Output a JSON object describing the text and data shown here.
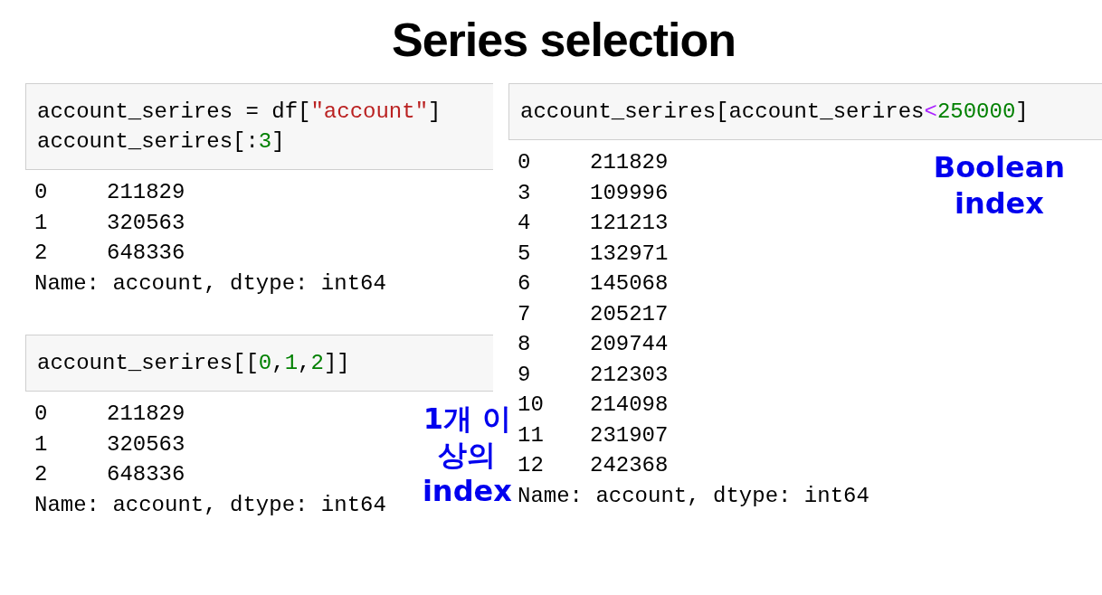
{
  "title": "Series selection",
  "columns": [
    [
      {
        "code_lines": [
          [
            {
              "kind": "plain",
              "text": "account_serires = df["
            },
            {
              "kind": "string",
              "text": "\"account\""
            },
            {
              "kind": "plain",
              "text": "]"
            }
          ],
          [
            {
              "kind": "plain",
              "text": "account_serires[:"
            },
            {
              "kind": "number",
              "text": "3"
            },
            {
              "kind": "plain",
              "text": "]"
            }
          ]
        ],
        "output_rows": [
          {
            "index": "0",
            "value": "211829"
          },
          {
            "index": "1",
            "value": "320563"
          },
          {
            "index": "2",
            "value": "648336"
          }
        ],
        "footer": "Name: account, dtype: int64"
      },
      {
        "code_lines": [
          [
            {
              "kind": "plain",
              "text": "account_serires[["
            },
            {
              "kind": "number",
              "text": "0"
            },
            {
              "kind": "plain",
              "text": ","
            },
            {
              "kind": "number",
              "text": "1"
            },
            {
              "kind": "plain",
              "text": ","
            },
            {
              "kind": "number",
              "text": "2"
            },
            {
              "kind": "plain",
              "text": "]]"
            }
          ]
        ],
        "output_rows": [
          {
            "index": "0",
            "value": "211829"
          },
          {
            "index": "1",
            "value": "320563"
          },
          {
            "index": "2",
            "value": "648336"
          }
        ],
        "footer": "Name: account, dtype: int64",
        "annotation": "1개 이상의\nindex"
      }
    ],
    [
      {
        "code_lines": [
          [
            {
              "kind": "plain",
              "text": "account_serires[account_serires"
            },
            {
              "kind": "operator",
              "text": "<"
            },
            {
              "kind": "number",
              "text": "250000"
            },
            {
              "kind": "plain",
              "text": "]"
            }
          ]
        ],
        "output_rows": [
          {
            "index": "0",
            "value": "211829"
          },
          {
            "index": "3",
            "value": "109996"
          },
          {
            "index": "4",
            "value": "121213"
          },
          {
            "index": "5",
            "value": "132971"
          },
          {
            "index": "6",
            "value": "145068"
          },
          {
            "index": "7",
            "value": "205217"
          },
          {
            "index": "8",
            "value": "209744"
          },
          {
            "index": "9",
            "value": "212303"
          },
          {
            "index": "10",
            "value": "214098"
          },
          {
            "index": "11",
            "value": "231907"
          },
          {
            "index": "12",
            "value": "242368"
          }
        ],
        "footer": "Name: account, dtype: int64",
        "annotation": "Boolean index"
      }
    ]
  ]
}
